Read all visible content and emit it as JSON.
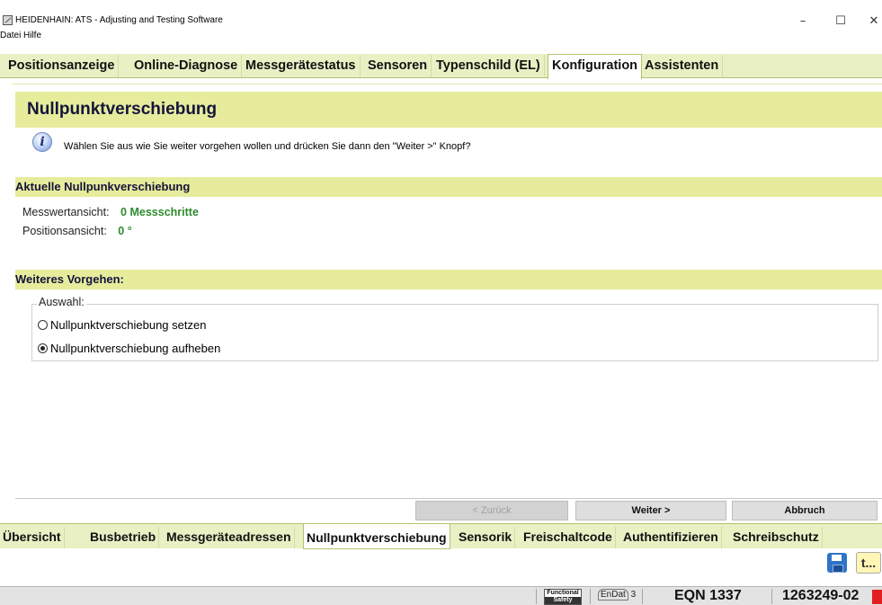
{
  "window": {
    "title": "HEIDENHAIN: ATS - Adjusting and Testing Software",
    "minimize": "–",
    "maximize": "☐",
    "close": "✕"
  },
  "menu": [
    "Datei",
    "Hilfe"
  ],
  "top_tabs": [
    {
      "label": "Positionsanzeige"
    },
    {
      "label": "Online-Diagnose"
    },
    {
      "label": "Messgerätestatus"
    },
    {
      "label": "Sensoren"
    },
    {
      "label": "Typenschild (EL)"
    },
    {
      "label": "Konfiguration",
      "active": true
    },
    {
      "label": "Assistenten"
    }
  ],
  "page": {
    "title": "Nullpunktverschiebung",
    "info_icon": "i",
    "info_text": "Wählen Sie aus wie Sie weiter vorgehen wollen und drücken Sie dann den \"Weiter >\" Knopf?"
  },
  "current_offset": {
    "header": "Aktuelle Nullpunkverschiebung",
    "rows": [
      {
        "label": "Messwertansicht:",
        "value": "0 Messschritte"
      },
      {
        "label": "Positionsansicht:",
        "value": "0 °"
      }
    ]
  },
  "procedure": {
    "header": "Weiteres Vorgehen:",
    "group_label": "Auswahl:",
    "options": [
      {
        "label": "Nullpunktverschiebung setzen",
        "checked": false
      },
      {
        "label": "Nullpunktverschiebung aufheben",
        "checked": true
      }
    ]
  },
  "buttons": {
    "back": "< Zurück",
    "next": "Weiter >",
    "cancel": "Abbruch"
  },
  "bottom_tabs": [
    {
      "label": "Übersicht"
    },
    {
      "label": "Busbetrieb"
    },
    {
      "label": "Messgeräteadressen"
    },
    {
      "label": "Nullpunktverschiebung",
      "active": true
    },
    {
      "label": "Sensorik"
    },
    {
      "label": "Freischaltcode"
    },
    {
      "label": "Authentifizieren"
    },
    {
      "label": "Schreibschutz"
    }
  ],
  "toolbar": {
    "help_label": "t..."
  },
  "status": {
    "functional_safety_top": "Functional",
    "functional_safety_bottom": "Safety",
    "endat_name": "EnDat",
    "endat_version": "3",
    "encoder": "EQN 1337",
    "id": "1263249-02"
  },
  "colors": {
    "accent": "#e6ec9c",
    "tab_bar": "#e8f0c4",
    "value_green": "#2e8b2e"
  },
  "icons": {
    "app": "heidenhain-app-icon",
    "info": "info-icon",
    "save": "save-icon",
    "help": "help-icon",
    "warning": "warning-icon"
  }
}
